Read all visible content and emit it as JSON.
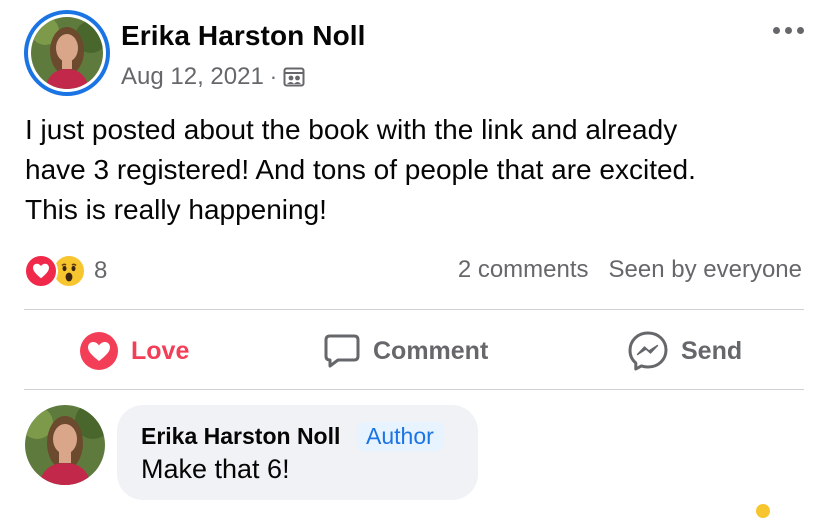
{
  "post": {
    "author": "Erika Harston Noll",
    "date": "Aug 12, 2021",
    "separator": "·",
    "audience_icon": "photo-album-icon",
    "body_lines": [
      "I just posted about the book with the link and already",
      "have 3 registered!  And tons of people that are excited.",
      "This is really happening!"
    ]
  },
  "reactions": {
    "icons": [
      "love-reaction-icon",
      "wow-reaction-icon"
    ],
    "count": "8",
    "comments_label": "2 comments",
    "visibility_label": "Seen by everyone"
  },
  "actions": {
    "love": "Love",
    "comment": "Comment",
    "send": "Send"
  },
  "comment": {
    "author": "Erika Harston Noll",
    "badge": "Author",
    "text": "Make that 6!"
  },
  "colors": {
    "brand_blue": "#1b74e4",
    "love_red": "#f33e58",
    "secondary_text": "#65676b",
    "bubble_bg": "#f0f2f5"
  }
}
